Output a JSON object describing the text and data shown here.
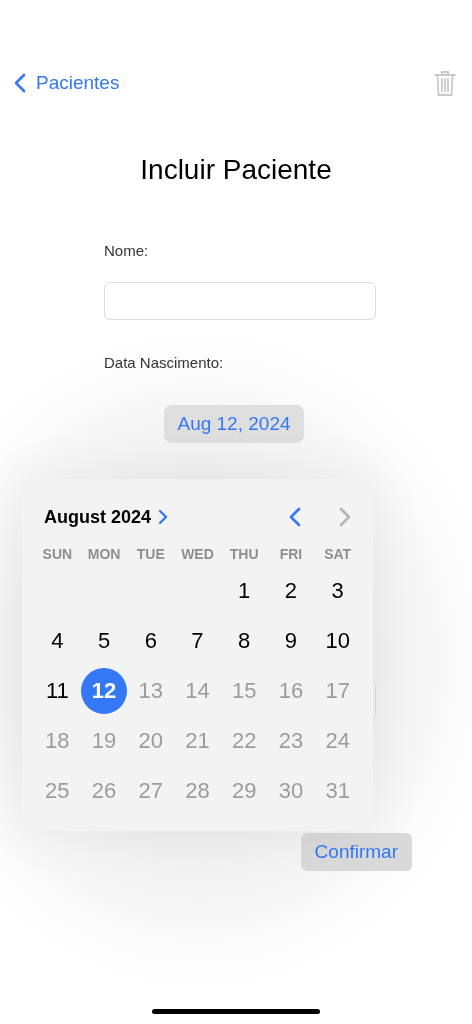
{
  "nav": {
    "back_label": "Pacientes"
  },
  "title": "Incluir Paciente",
  "form": {
    "name_label": "Nome:",
    "birth_label": "Data Nascimento:",
    "date_value": "Aug 12, 2024",
    "confirm_label": "Confirmar"
  },
  "calendar": {
    "month_label": "August 2024",
    "prev_disabled": false,
    "next_disabled": true,
    "weekdays": [
      "SUN",
      "MON",
      "TUE",
      "WED",
      "THU",
      "FRI",
      "SAT"
    ],
    "weeks": [
      [
        {
          "day": "1",
          "selected": false,
          "disabled": false
        },
        {
          "day": "2",
          "selected": false,
          "disabled": false
        },
        {
          "day": "3",
          "selected": false,
          "disabled": false
        }
      ],
      [
        {
          "day": "4",
          "selected": false,
          "disabled": false
        },
        {
          "day": "5",
          "selected": false,
          "disabled": false
        },
        {
          "day": "6",
          "selected": false,
          "disabled": false
        },
        {
          "day": "7",
          "selected": false,
          "disabled": false
        },
        {
          "day": "8",
          "selected": false,
          "disabled": false
        },
        {
          "day": "9",
          "selected": false,
          "disabled": false
        },
        {
          "day": "10",
          "selected": false,
          "disabled": false
        }
      ],
      [
        {
          "day": "11",
          "selected": false,
          "disabled": false
        },
        {
          "day": "12",
          "selected": true,
          "disabled": false
        },
        {
          "day": "13",
          "selected": false,
          "disabled": true
        },
        {
          "day": "14",
          "selected": false,
          "disabled": true
        },
        {
          "day": "15",
          "selected": false,
          "disabled": true
        },
        {
          "day": "16",
          "selected": false,
          "disabled": true
        },
        {
          "day": "17",
          "selected": false,
          "disabled": true
        }
      ],
      [
        {
          "day": "18",
          "selected": false,
          "disabled": true
        },
        {
          "day": "19",
          "selected": false,
          "disabled": true
        },
        {
          "day": "20",
          "selected": false,
          "disabled": true
        },
        {
          "day": "21",
          "selected": false,
          "disabled": true
        },
        {
          "day": "22",
          "selected": false,
          "disabled": true
        },
        {
          "day": "23",
          "selected": false,
          "disabled": true
        },
        {
          "day": "24",
          "selected": false,
          "disabled": true
        }
      ],
      [
        {
          "day": "25",
          "selected": false,
          "disabled": true
        },
        {
          "day": "26",
          "selected": false,
          "disabled": true
        },
        {
          "day": "27",
          "selected": false,
          "disabled": true
        },
        {
          "day": "28",
          "selected": false,
          "disabled": true
        },
        {
          "day": "29",
          "selected": false,
          "disabled": true
        },
        {
          "day": "30",
          "selected": false,
          "disabled": true
        },
        {
          "day": "31",
          "selected": false,
          "disabled": true
        }
      ]
    ]
  }
}
